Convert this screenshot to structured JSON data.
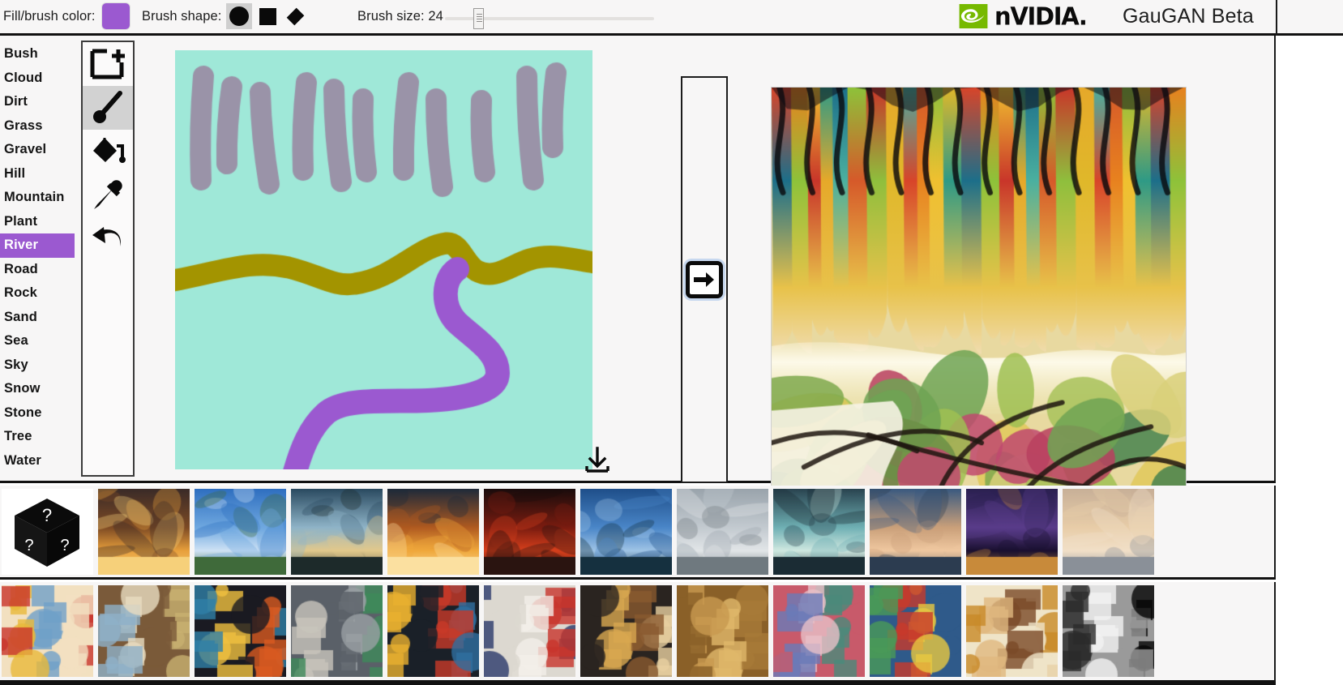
{
  "toolbar": {
    "fill_color_label": "Fill/brush color:",
    "fill_color_value": "#9b59d0",
    "brush_shape_label": "Brush shape:",
    "brush_shapes": [
      {
        "name": "circle",
        "selected": true
      },
      {
        "name": "square",
        "selected": false
      },
      {
        "name": "diamond",
        "selected": false
      }
    ],
    "brush_size_label": "Brush size: 24",
    "brush_size_value": 24,
    "slider_min": 1,
    "slider_max": 100,
    "brand_word": "nVIDIA.",
    "brand_green": "#76b900",
    "app_title": "GauGAN Beta"
  },
  "segment_labels": {
    "selected": "River",
    "selected_color": "#9b59d0",
    "items": [
      {
        "label": "Bush"
      },
      {
        "label": "Cloud"
      },
      {
        "label": "Dirt"
      },
      {
        "label": "Grass"
      },
      {
        "label": "Gravel"
      },
      {
        "label": "Hill"
      },
      {
        "label": "Mountain"
      },
      {
        "label": "Plant"
      },
      {
        "label": "River"
      },
      {
        "label": "Road"
      },
      {
        "label": "Rock"
      },
      {
        "label": "Sand"
      },
      {
        "label": "Sea"
      },
      {
        "label": "Sky"
      },
      {
        "label": "Snow"
      },
      {
        "label": "Stone"
      },
      {
        "label": "Tree"
      },
      {
        "label": "Water"
      }
    ]
  },
  "tools": {
    "items": [
      {
        "name": "new-canvas-tool",
        "icon": "new-canvas-icon",
        "selected": false
      },
      {
        "name": "brush-tool",
        "icon": "paintbrush-icon",
        "selected": true
      },
      {
        "name": "fill-tool",
        "icon": "paint-bucket-icon",
        "selected": false
      },
      {
        "name": "eyedropper-tool",
        "icon": "eyedropper-icon",
        "selected": false
      },
      {
        "name": "undo-tool",
        "icon": "undo-arrow-icon",
        "selected": false
      }
    ]
  },
  "canvas": {
    "background_color": "#9fe8d8",
    "stroke_colors": {
      "tree": "#9a93a8",
      "hill": "#a39400",
      "river": "#9b59d0"
    },
    "download_icon": "download-icon"
  },
  "generate": {
    "button_icon": "arrow-right-icon",
    "focus_ring_color": "#c7d8ef"
  },
  "output": {
    "download_icon": "download-icon"
  },
  "scene_strip": {
    "items": [
      {
        "name": "random-scene",
        "kind": "random-cube"
      },
      {
        "name": "scene-tree-sunset",
        "kind": "photo"
      },
      {
        "name": "scene-highway-clouds",
        "kind": "photo"
      },
      {
        "name": "scene-lake-dusk",
        "kind": "photo"
      },
      {
        "name": "scene-ocean-sunset",
        "kind": "photo"
      },
      {
        "name": "scene-red-sky",
        "kind": "photo"
      },
      {
        "name": "scene-blue-fjord",
        "kind": "photo"
      },
      {
        "name": "scene-grey-beach",
        "kind": "photo"
      },
      {
        "name": "scene-night-water",
        "kind": "photo"
      },
      {
        "name": "scene-pink-clouds",
        "kind": "photo"
      },
      {
        "name": "scene-purple-lake",
        "kind": "photo"
      },
      {
        "name": "scene-hazy-sunset",
        "kind": "photo"
      }
    ]
  },
  "style_strip": {
    "items": [
      {
        "name": "style-abstract-florals",
        "kind": "art"
      },
      {
        "name": "style-stained-glass",
        "kind": "art"
      },
      {
        "name": "style-umbrella-rain",
        "kind": "art"
      },
      {
        "name": "style-grey-cubist",
        "kind": "art"
      },
      {
        "name": "style-colorful-cubist",
        "kind": "art"
      },
      {
        "name": "style-red-handprint",
        "kind": "art"
      },
      {
        "name": "style-tan-collage",
        "kind": "art"
      },
      {
        "name": "style-gold-spiral",
        "kind": "art"
      },
      {
        "name": "style-blue-portrait",
        "kind": "art"
      },
      {
        "name": "style-green-interior",
        "kind": "art"
      },
      {
        "name": "style-self-portrait",
        "kind": "art"
      },
      {
        "name": "style-black-white-lines",
        "kind": "art"
      }
    ]
  }
}
